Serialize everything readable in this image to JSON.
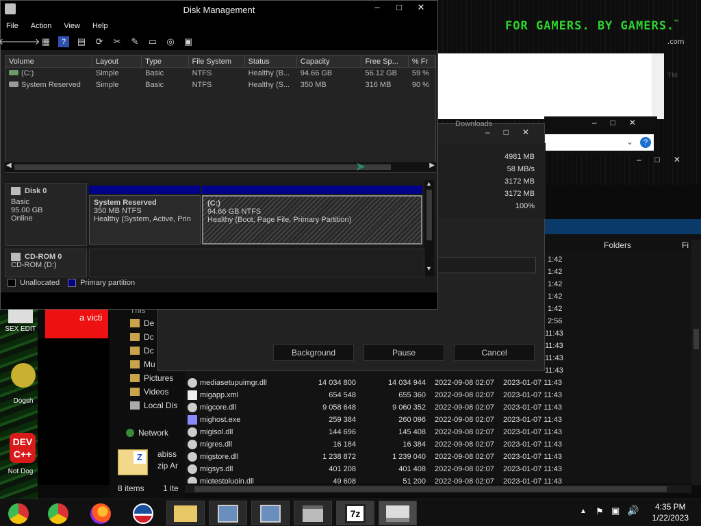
{
  "desktop": {
    "slogan": "FOR GAMERS. BY GAMERS.",
    "slogan_tm": "™",
    "slogan_com": ".com",
    "icons": [
      {
        "label": "SEX EDIT"
      },
      {
        "label": "Dogsh"
      },
      {
        "label": "Not Dog"
      }
    ],
    "ad_text": "a victi"
  },
  "disk_management": {
    "title": "Disk Management",
    "menu": [
      "File",
      "Action",
      "View",
      "Help"
    ],
    "columns": [
      "Volume",
      "Layout",
      "Type",
      "File System",
      "Status",
      "Capacity",
      "Free Sp...",
      "% Fr"
    ],
    "rows": [
      [
        "(C:)",
        "Simple",
        "Basic",
        "NTFS",
        "Healthy (B...",
        "94.66 GB",
        "56.12 GB",
        "59 %"
      ],
      [
        "System Reserved",
        "Simple",
        "Basic",
        "NTFS",
        "Healthy (S...",
        "350 MB",
        "316 MB",
        "90 %"
      ]
    ],
    "disk0": {
      "name": "Disk 0",
      "type": "Basic",
      "size": "95.00 GB",
      "state": "Online",
      "partitions": [
        {
          "name": "System Reserved",
          "size": "350 MB NTFS",
          "status": "Healthy (System, Active, Prin"
        },
        {
          "name": "(C:)",
          "size": "94.66 GB NTFS",
          "status": "Healthy (Boot, Page File, Primary Partition)"
        }
      ]
    },
    "cdrom": {
      "name": "CD-ROM 0",
      "drive": "CD-ROM (D:)"
    },
    "legend": [
      "Unallocated",
      "Primary partition"
    ]
  },
  "copy_dialog": {
    "header": "Downloads",
    "values": [
      "4981 MB",
      "58 MB/s",
      "3172 MB",
      "3172 MB",
      "100%"
    ],
    "buttons": [
      "Background",
      "Pause",
      "Cancel"
    ]
  },
  "file_manager": {
    "folders_header": "Folders",
    "fi_header": "Fi",
    "nav": [
      "De",
      "Dc",
      "Dc",
      "Mu",
      "Pictures",
      "Videos",
      "Local Dis",
      "Network"
    ],
    "nav_this": "This",
    "status_items": "8 items",
    "status_sel": "1 ite",
    "archive_label1": "abiss",
    "archive_label2": "zip Ar",
    "time_column_partial": [
      "1:42",
      "1:42",
      "1:42",
      "1:42",
      "1:42",
      "2:56",
      "11:43",
      "11:43",
      "11:43",
      "11:43"
    ],
    "files": [
      {
        "name": "mediasetupuimgr.dll",
        "size": "14 034 800",
        "alloc": "14 034 944",
        "modified": "2022-09-08 02:07",
        "created": "2023-01-07 11:43"
      },
      {
        "name": "migapp.xml",
        "size": "654 548",
        "alloc": "655 360",
        "modified": "2022-09-08 02:07",
        "created": "2023-01-07 11:43"
      },
      {
        "name": "migcore.dll",
        "size": "9 058 648",
        "alloc": "9 060 352",
        "modified": "2022-09-08 02:07",
        "created": "2023-01-07 11:43"
      },
      {
        "name": "mighost.exe",
        "size": "259 384",
        "alloc": "260 096",
        "modified": "2022-09-08 02:07",
        "created": "2023-01-07 11:43"
      },
      {
        "name": "migisol.dll",
        "size": "144 696",
        "alloc": "145 408",
        "modified": "2022-09-08 02:07",
        "created": "2023-01-07 11:43"
      },
      {
        "name": "migres.dll",
        "size": "16 184",
        "alloc": "16 384",
        "modified": "2022-09-08 02:07",
        "created": "2023-01-07 11:43"
      },
      {
        "name": "migstore.dll",
        "size": "1 238 872",
        "alloc": "1 239 040",
        "modified": "2022-09-08 02:07",
        "created": "2023-01-07 11:43"
      },
      {
        "name": "migsys.dll",
        "size": "401 208",
        "alloc": "401 408",
        "modified": "2022-09-08 02:07",
        "created": "2023-01-07 11:43"
      },
      {
        "name": "migtestplugin.dll",
        "size": "49 608",
        "alloc": "51 200",
        "modified": "2022-09-08 02:07",
        "created": "2023-01-07 11:43"
      }
    ]
  },
  "taskbar": {
    "time": "4:35 PM",
    "date": "1/22/2023",
    "pinned": [
      "chrome-icon",
      "chrome-icon",
      "firefox-icon",
      "obama-logo-icon"
    ],
    "apps": [
      "file-explorer-icon",
      "setup-icon",
      "setup-icon",
      "disk-cleanup-icon",
      "7zip-icon",
      "disk-management-icon"
    ],
    "app_7z_label": "7z"
  },
  "colors": {
    "primary_partition": "#000088",
    "slogan_green": "#2fd52f"
  }
}
